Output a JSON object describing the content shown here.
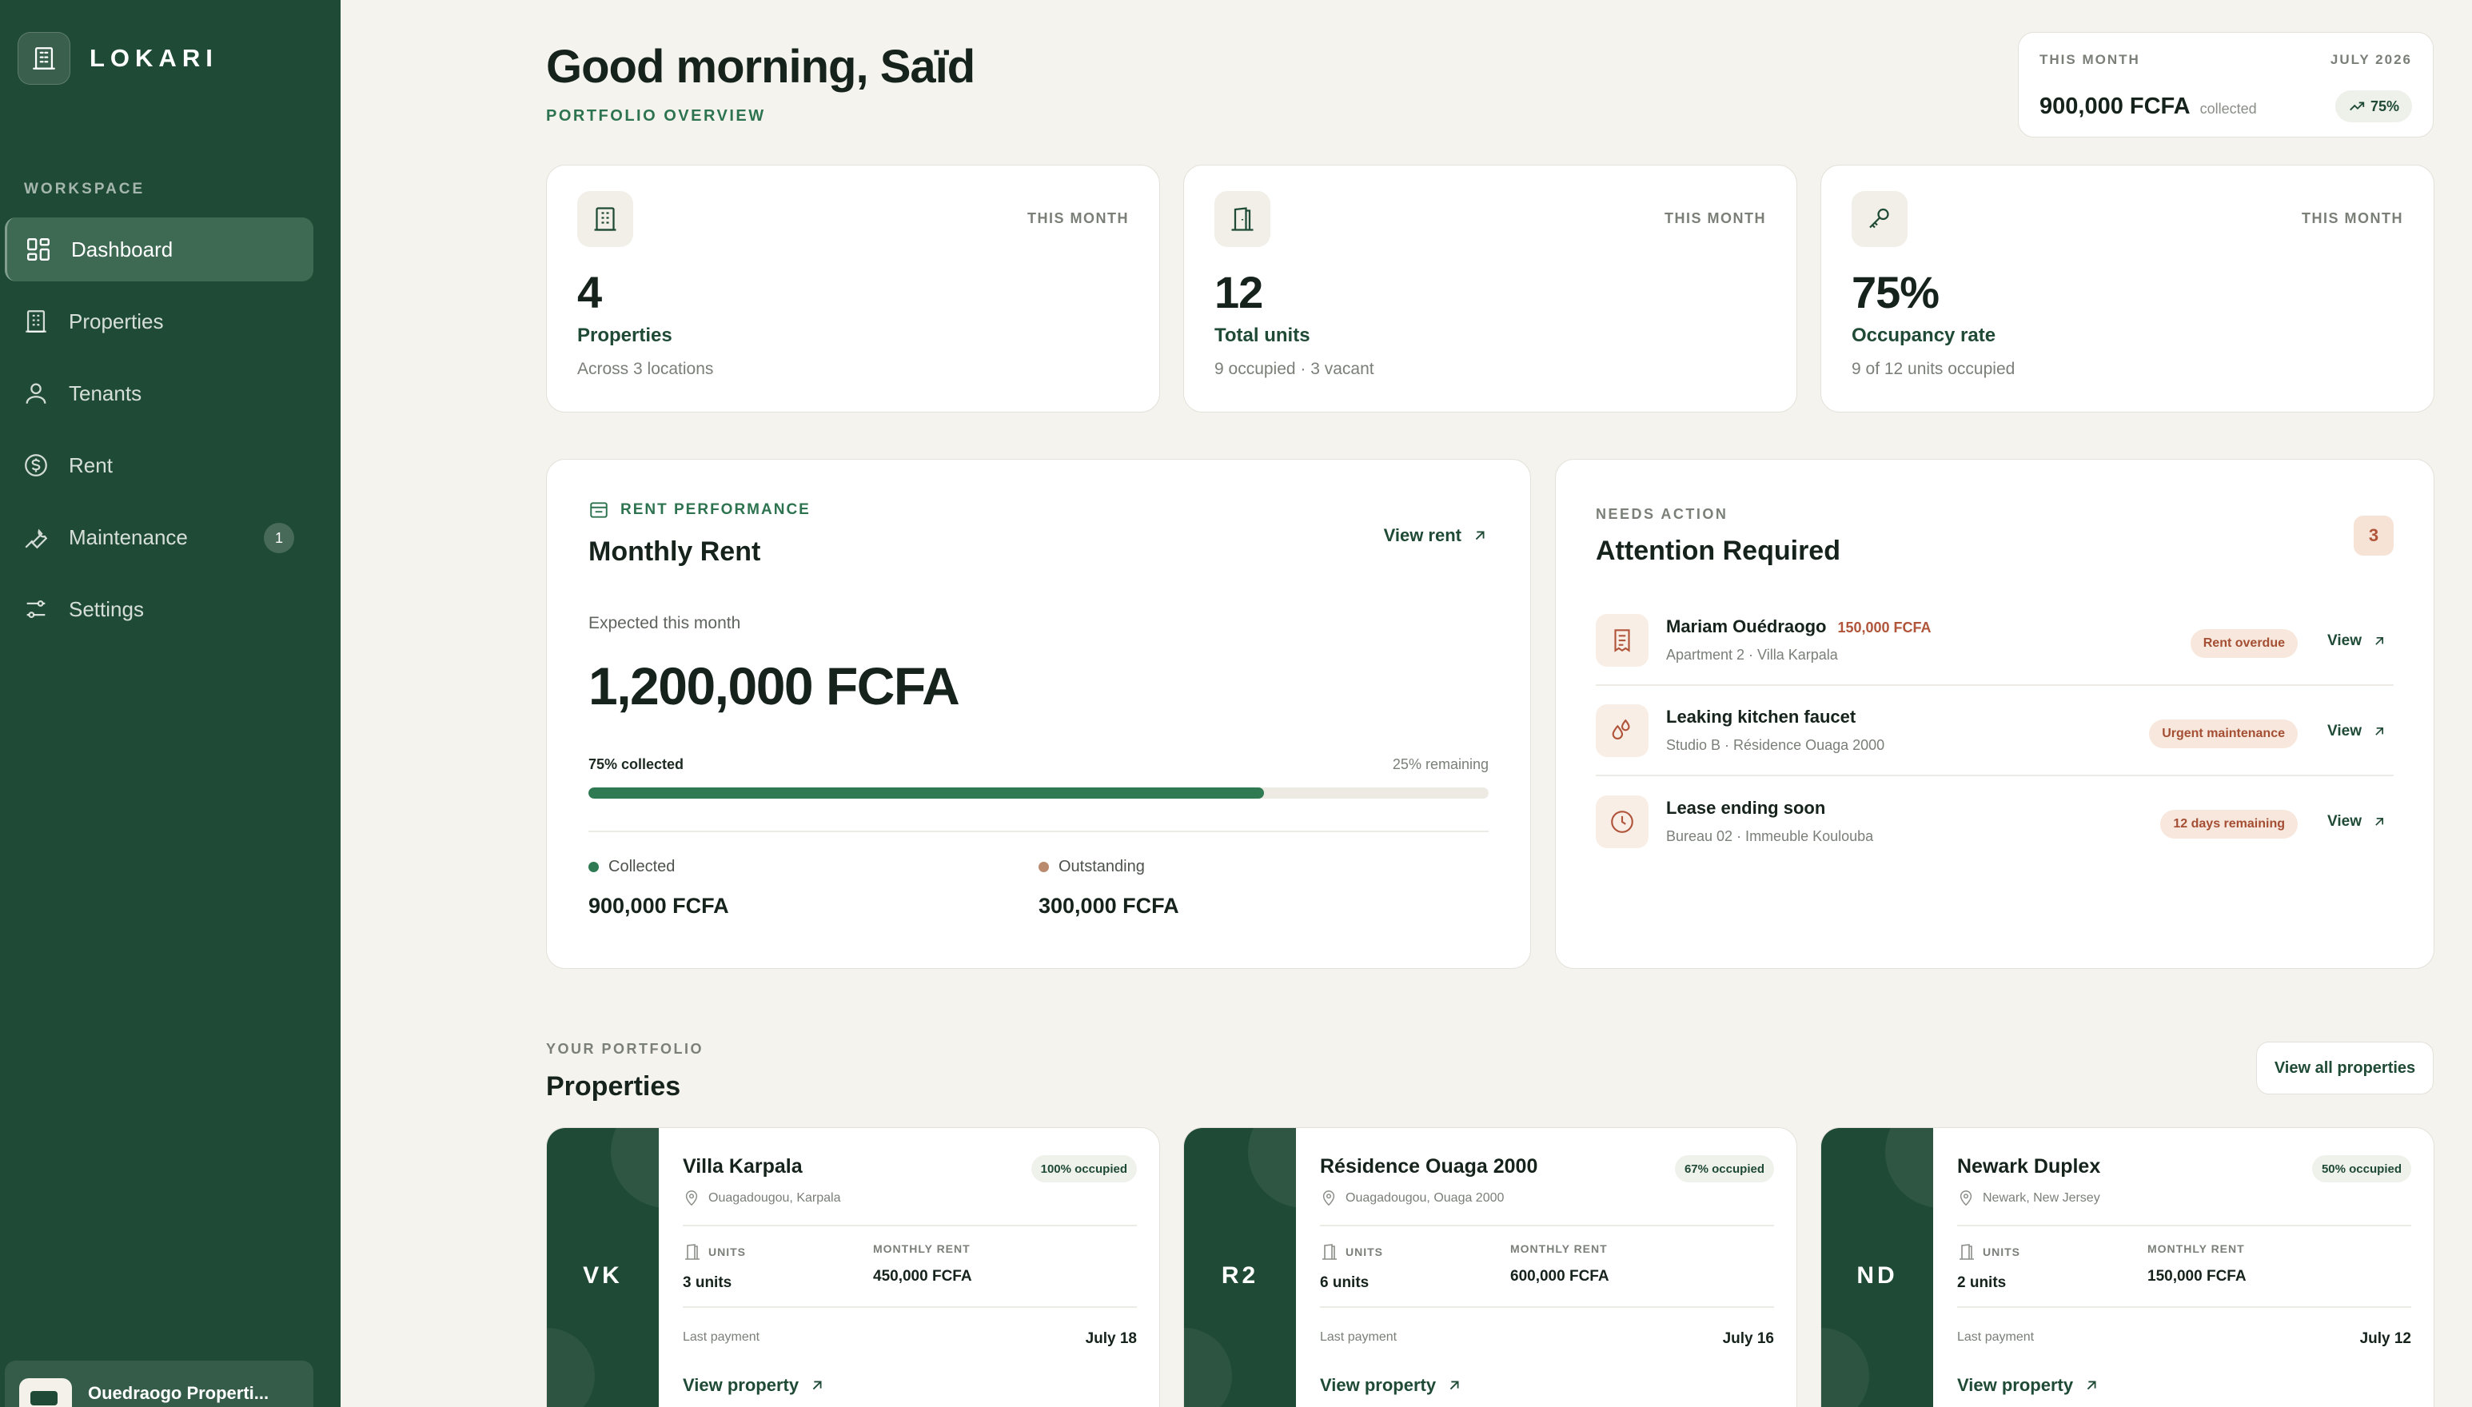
{
  "brand": {
    "name": "LOKARI"
  },
  "sidebar": {
    "section_label": "WORKSPACE",
    "items": [
      {
        "label": "Dashboard",
        "icon": "dashboard-icon",
        "active": true
      },
      {
        "label": "Properties",
        "icon": "building-icon"
      },
      {
        "label": "Tenants",
        "icon": "user-icon"
      },
      {
        "label": "Rent",
        "icon": "dollar-icon"
      },
      {
        "label": "Maintenance",
        "icon": "wrench-icon",
        "badge": "1"
      },
      {
        "label": "Settings",
        "icon": "sliders-icon"
      }
    ],
    "account_name": "Ouedraogo Properti..."
  },
  "header": {
    "greeting": "Good morning, Saïd",
    "subtitle": "PORTFOLIO OVERVIEW"
  },
  "summary": {
    "period": "THIS MONTH",
    "date": "JULY 2026",
    "amount": "900,000 FCFA",
    "amount_suffix": "collected",
    "trend": "75%"
  },
  "stats": [
    {
      "period": "THIS MONTH",
      "value": "4",
      "label": "Properties",
      "sub": "Across 3 locations",
      "icon": "building-icon"
    },
    {
      "period": "THIS MONTH",
      "value": "12",
      "label": "Total units",
      "sub": "9 occupied · 3 vacant",
      "icon": "door-icon"
    },
    {
      "period": "THIS MONTH",
      "value": "75%",
      "label": "Occupancy rate",
      "sub": "9 of 12 units occupied",
      "icon": "key-icon"
    }
  ],
  "rent": {
    "eyebrow": "RENT PERFORMANCE",
    "title": "Monthly Rent",
    "view_link": "View rent",
    "expected_label": "Expected this month",
    "expected_amount": "1,200,000 FCFA",
    "collected_pct_label": "75% collected",
    "remaining_label": "25% remaining",
    "collected_fraction": 0.75,
    "collected_label": "Collected",
    "collected_amount": "900,000 FCFA",
    "outstanding_label": "Outstanding",
    "outstanding_amount": "300,000 FCFA",
    "colors": {
      "collected": "#2f7a52",
      "outstanding": "#b98a6e"
    }
  },
  "attention": {
    "eyebrow": "NEEDS ACTION",
    "title": "Attention Required",
    "count": "3",
    "items": [
      {
        "title": "Mariam Ouédraogo",
        "amount": "150,000 FCFA",
        "sub": "Apartment 2 · Villa Karpala",
        "tag": "Rent overdue",
        "action": "View",
        "icon": "receipt-icon"
      },
      {
        "title": "Leaking kitchen faucet",
        "amount": "",
        "sub": "Studio B · Résidence Ouaga 2000",
        "tag": "Urgent maintenance",
        "action": "View",
        "icon": "droplets-icon"
      },
      {
        "title": "Lease ending soon",
        "amount": "",
        "sub": "Bureau 02 · Immeuble Koulouba",
        "tag": "12 days remaining",
        "action": "View",
        "icon": "clock-icon"
      }
    ]
  },
  "portfolio": {
    "eyebrow": "YOUR PORTFOLIO",
    "title": "Properties",
    "view_all": "View all properties",
    "units_label": "UNITS",
    "rent_label": "MONTHLY RENT",
    "last_payment_label": "Last payment",
    "link_label": "View property",
    "properties": [
      {
        "initials": "VK",
        "name": "Villa Karpala",
        "occupancy": "100% occupied",
        "location": "Ouagadougou, Karpala",
        "units": "3 units",
        "rent": "450,000 FCFA",
        "last_payment": "July 18"
      },
      {
        "initials": "R2",
        "name": "Résidence Ouaga 2000",
        "occupancy": "67% occupied",
        "location": "Ouagadougou, Ouaga 2000",
        "units": "6 units",
        "rent": "600,000 FCFA",
        "last_payment": "July 16"
      },
      {
        "initials": "ND",
        "name": "Newark Duplex",
        "occupancy": "50% occupied",
        "location": "Newark, New Jersey",
        "units": "2 units",
        "rent": "150,000 FCFA",
        "last_payment": "July 12"
      }
    ]
  }
}
